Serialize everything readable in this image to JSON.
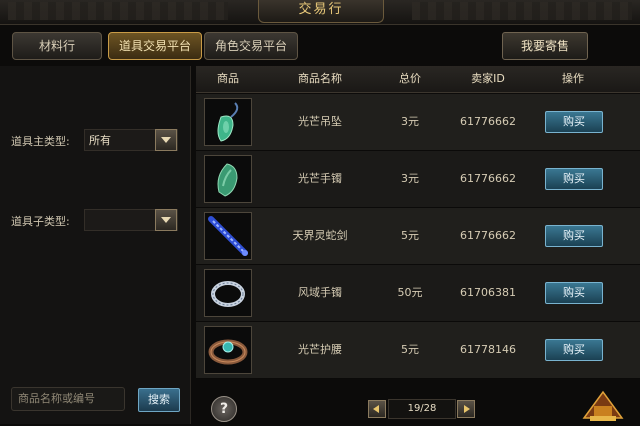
{
  "window": {
    "title": "交易行"
  },
  "tabs": [
    {
      "label": "材料行",
      "active": false
    },
    {
      "label": "道具交易平台",
      "active": true
    },
    {
      "label": "角色交易平台",
      "active": false
    }
  ],
  "sell_button": "我要寄售",
  "filters": {
    "main_type_label": "道具主类型:",
    "main_type_value": "所有",
    "sub_type_label": "道具子类型:",
    "sub_type_value": ""
  },
  "search": {
    "placeholder": "商品名称或编号",
    "button": "搜索"
  },
  "table": {
    "headers": [
      "商品",
      "商品名称",
      "总价",
      "卖家ID",
      "操作"
    ],
    "rows": [
      {
        "icon": "jade-pendant",
        "name": "光芒吊坠",
        "price": "3元",
        "seller": "61776662",
        "action": "购买"
      },
      {
        "icon": "jade-bracelet",
        "name": "光芒手镯",
        "price": "3元",
        "seller": "61776662",
        "action": "购买"
      },
      {
        "icon": "blue-sword",
        "name": "天界灵蛇剑",
        "price": "5元",
        "seller": "61776662",
        "action": "购买"
      },
      {
        "icon": "silver-bracelet",
        "name": "风域手镯",
        "price": "50元",
        "seller": "61706381",
        "action": "购买"
      },
      {
        "icon": "jeweled-belt",
        "name": "光芒护腰",
        "price": "5元",
        "seller": "61778146",
        "action": "购买"
      }
    ]
  },
  "pager": {
    "text": "19/28"
  },
  "help": "?"
}
